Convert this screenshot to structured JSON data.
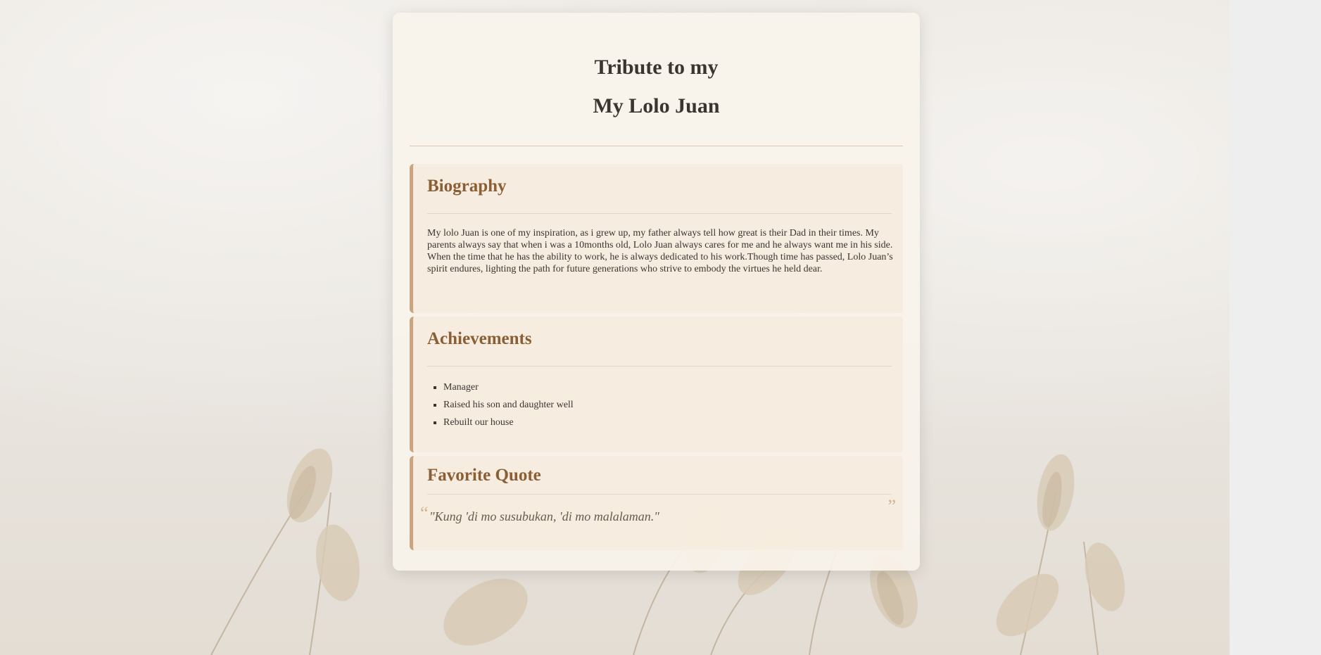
{
  "page": {
    "title_line_1": "Tribute to my",
    "title_line_2": "My Lolo Juan"
  },
  "biography": {
    "heading": "Biography",
    "text": "My lolo Juan is one of my inspiration, as i grew up, my father always tell how great is their Dad in their times. My parents always say that when i was a 10months old, Lolo Juan always cares for me and he always want me in his side. When the time that he has the ability to work, he is always dedicated to his work.Though time has passed, Lolo Juan’s spirit endures, lighting the path for future generations who strive to embody the virtues he held dear."
  },
  "achievements": {
    "heading": "Achievements",
    "items": [
      "Manager",
      "Raised his son and daughter well",
      "Rebuilt our house"
    ]
  },
  "favorite_quote": {
    "heading": "Favorite Quote",
    "open_mark": "“",
    "close_mark": "”",
    "text": "\"Kung 'di mo susubukan, 'di mo malalaman.\""
  },
  "colors": {
    "accent": "#c9a47c",
    "heading": "#8b5e34",
    "card_bg": "#f8f4eb",
    "section_bg": "#f6ecde"
  }
}
